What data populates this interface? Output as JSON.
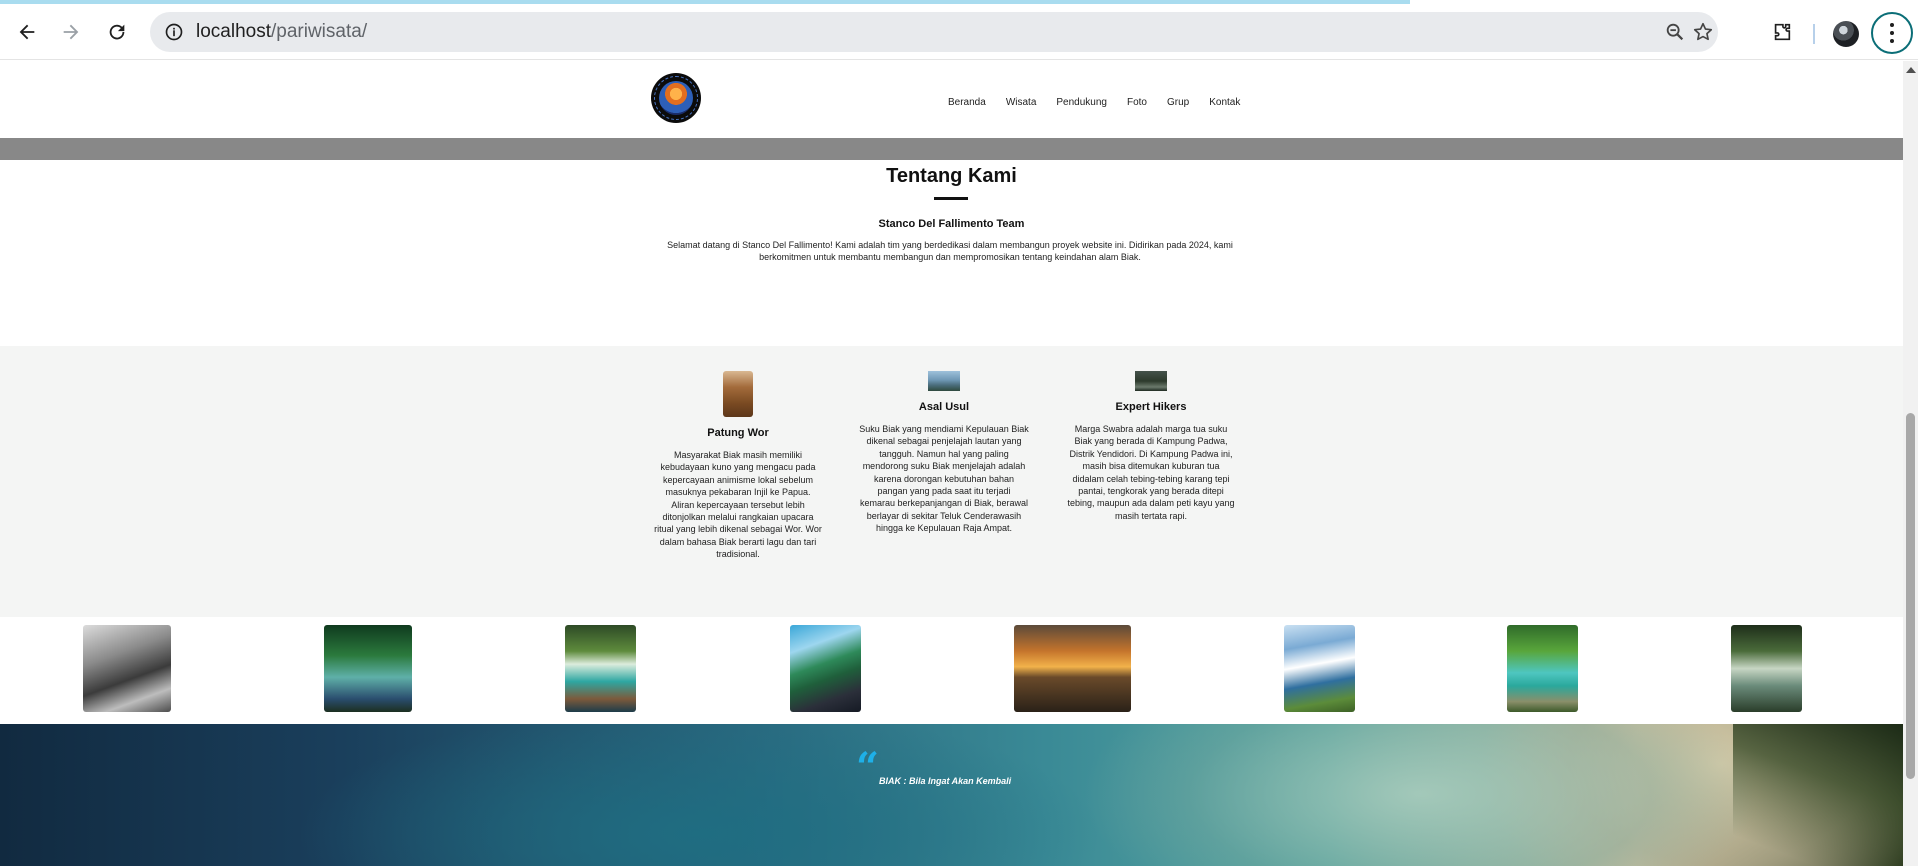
{
  "browser": {
    "url_host": "localhost",
    "url_path": "/pariwisata/"
  },
  "nav": {
    "items": [
      "Beranda",
      "Wisata",
      "Pendukung",
      "Foto",
      "Grup",
      "Kontak"
    ]
  },
  "about": {
    "title": "Tentang Kami",
    "team": "Stanco Del Fallimento Team",
    "text": "Selamat datang di Stanco Del Fallimento! Kami adalah tim yang berdedikasi dalam membangun proyek website ini. Didirikan pada 2024, kami berkomitmen untuk membantu membangun dan mempromosikan tentang keindahan alam Biak."
  },
  "features": [
    {
      "title": "Patung Wor",
      "text": "Masyarakat Biak masih memiliki kebudayaan kuno yang mengacu pada kepercayaan animisme lokal sebelum masuknya pekabaran Injil ke Papua. Aliran kepercayaan tersebut lebih ditonjolkan melalui rangkaian upacara ritual yang lebih dikenal sebagai Wor. Wor dalam bahasa Biak berarti lagu dan tari tradisional."
    },
    {
      "title": "Asal Usul",
      "text": "Suku Biak yang mendiami Kepulauan Biak dikenal sebagai penjelajah lautan yang tangguh. Namun hal yang paling mendorong suku Biak menjelajah adalah karena dorongan kebutuhan bahan pangan yang pada saat itu terjadi kemarau berkepanjangan di Biak, berawal berlayar di sekitar Teluk Cenderawasih hingga ke Kepulauan Raja Ampat."
    },
    {
      "title": "Expert Hikers",
      "text": "Marga Swabra adalah marga tua suku Biak yang berada di Kampung Padwa, Distrik Yendidori. Di Kampung Padwa ini, masih bisa ditemukan kuburan tua didalam celah tebing-tebing karang tepi pantai, tengkorak yang berada ditepi tebing, maupun ada dalam peti kayu yang masih tertata rapi."
    }
  ],
  "banner": {
    "quote_mark": "“",
    "quote": "BIAK : Bila Ingat Akan Kembali"
  }
}
